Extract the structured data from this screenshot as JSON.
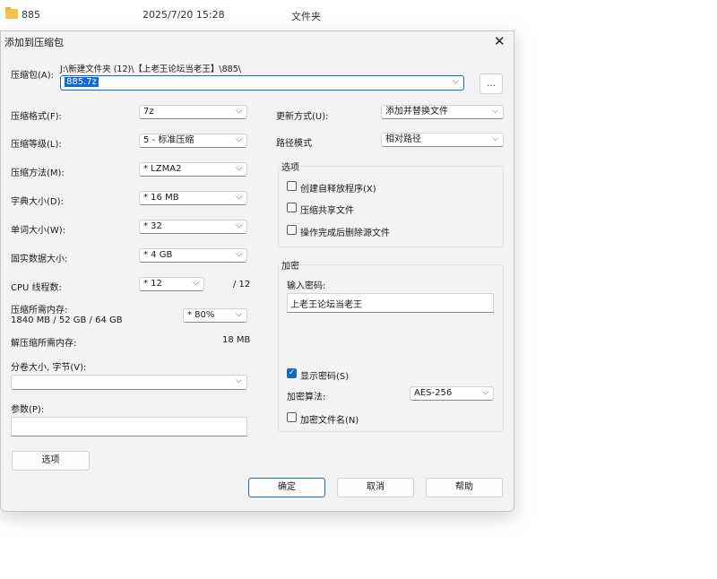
{
  "background_row": {
    "name": "885",
    "date": "2025/7/20 15:28",
    "type": "文件夹"
  },
  "dialog": {
    "title": "添加到压缩包",
    "archive_label": "压缩包(A):",
    "archive_path": "J:\\新建文件夹 (12)\\【上老王论坛当老王】\\885\\",
    "archive_name": "885.7z",
    "browse_label": "...",
    "format_label": "压缩格式(F):",
    "format_value": "7z",
    "level_label": "压缩等级(L):",
    "level_value": "5 - 标准压缩",
    "method_label": "压缩方法(M):",
    "method_value": "* LZMA2",
    "dict_label": "字典大小(D):",
    "dict_value": "* 16 MB",
    "word_label": "单词大小(W):",
    "word_value": "* 32",
    "solid_label": "固实数据大小:",
    "solid_value": "* 4 GB",
    "threads_label": "CPU 线程数:",
    "threads_value": "* 12",
    "threads_max": "/ 12",
    "mem_label": "压缩所需内存:",
    "mem_detail": "1840 MB / 52 GB / 64 GB",
    "mem_value": "* 80%",
    "decomp_label": "解压缩所需内存:",
    "decomp_value": "18 MB",
    "volume_label": "分卷大小, 字节(V):",
    "volume_value": "",
    "params_label": "参数(P):",
    "params_value": "",
    "update_label": "更新方式(U):",
    "update_value": "添加并替换文件",
    "pathmode_label": "路径模式",
    "pathmode_value": "相对路径",
    "options_group": "选项",
    "opt_sfx": "创建自释放程序(X)",
    "opt_shared": "压缩共享文件",
    "opt_delete": "操作完成后删除源文件",
    "enc_group": "加密",
    "pwd_label": "输入密码:",
    "pwd_value": "上老王论坛当老王",
    "show_pwd": "显示密码(S)",
    "enc_method_label": "加密算法:",
    "enc_method_value": "AES-256",
    "enc_names": "加密文件名(N)",
    "options_button": "选项",
    "ok": "确定",
    "cancel": "取消",
    "help": "帮助"
  },
  "colors": {
    "accent": "#1769c4",
    "folder": "#f4c24e",
    "dialog_bg": "#f3f3f3"
  }
}
